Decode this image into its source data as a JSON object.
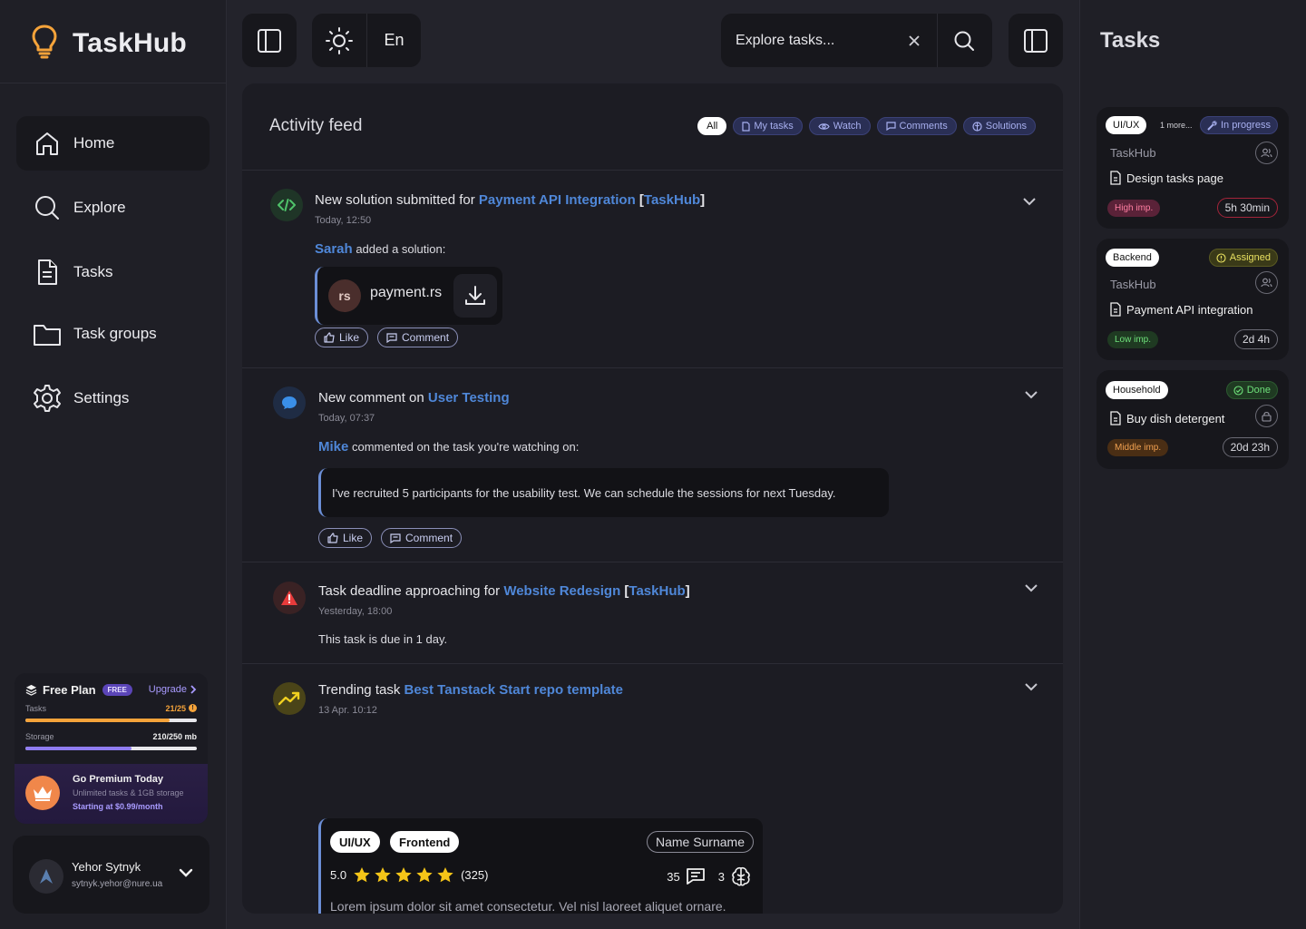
{
  "app": {
    "name": "TaskHub"
  },
  "sidebar": {
    "items": [
      {
        "label": "Home",
        "icon": "home-icon",
        "active": true
      },
      {
        "label": "Explore",
        "icon": "search-icon"
      },
      {
        "label": "Tasks",
        "icon": "document-icon"
      },
      {
        "label": "Task groups",
        "icon": "folder-icon"
      },
      {
        "label": "Settings",
        "icon": "gear-icon"
      }
    ],
    "plan": {
      "title": "Free Plan",
      "badge": "FREE",
      "upgrade": "Upgrade",
      "tasks_label": "Tasks",
      "tasks_value": "21/25",
      "tasks_fraction": 0.84,
      "storage_label": "Storage",
      "storage_value": "210/250 mb",
      "storage_fraction": 0.62,
      "premium_title": "Go Premium Today",
      "premium_subtitle": "Unlimited tasks & 1GB storage",
      "premium_price": "Starting at $0.99/month"
    },
    "user": {
      "name": "Yehor Sytnyk",
      "email": "sytnyk.yehor@nure.ua"
    }
  },
  "topbar": {
    "language": "En",
    "search_placeholder": "Explore tasks..."
  },
  "feed": {
    "title": "Activity feed",
    "filters": [
      {
        "label": "All",
        "icon": "",
        "active": true
      },
      {
        "label": "My tasks",
        "icon": "document-icon"
      },
      {
        "label": "Watch",
        "icon": "eye-icon"
      },
      {
        "label": "Comments",
        "icon": "comment-icon"
      },
      {
        "label": "Solutions",
        "icon": "brain-icon"
      }
    ],
    "items": [
      {
        "type": "solution",
        "prefix": "New solution submitted for ",
        "link": "Payment API Integration",
        "group": "TaskHub",
        "time": "Today, 12:50",
        "actor": "Sarah",
        "action": " added a solution:",
        "file_ext": "rs",
        "file_name": "payment.rs",
        "like": "Like",
        "comment": "Comment"
      },
      {
        "type": "comment",
        "prefix": "New comment on ",
        "link": "User Testing",
        "time": "Today, 07:37",
        "actor": "Mike",
        "action": " commented on the task you're watching on:",
        "quote": "I've recruited 5 participants for the usability test. We can schedule the sessions for next Tuesday.",
        "like": "Like",
        "comment": "Comment"
      },
      {
        "type": "deadline",
        "prefix": "Task deadline approaching for ",
        "link": "Website Redesign",
        "group": "TaskHub",
        "time": "Yesterday, 18:00",
        "body": "This task is due in 1 day."
      },
      {
        "type": "trending",
        "prefix": "Trending task ",
        "link": "Best Tanstack Start repo template",
        "time": "13 Apr. 10:12",
        "tags": [
          "UI/UX",
          "Frontend"
        ],
        "owner": "Name Surname",
        "rating": "5.0",
        "stars": 5,
        "reviews": "(325)",
        "comments_count": "35",
        "solutions_count": "3",
        "description": "Lorem ipsum dolor sit amet consectetur. Vel nisl laoreet aliquet ornare."
      }
    ]
  },
  "tasks_panel": {
    "title": "Tasks",
    "cards": [
      {
        "category": "UI/UX",
        "more": "1 more...",
        "status": "In progress",
        "status_icon": "wrench-icon",
        "project": "TaskHub",
        "name": "Design tasks page",
        "importance": "High imp.",
        "duration": "5h 30min",
        "right_icon": "users-icon"
      },
      {
        "category": "Backend",
        "status": "Assigned",
        "status_icon": "alert-circle-icon",
        "project": "TaskHub",
        "name": "Payment API integration",
        "importance": "Low imp.",
        "duration": "2d 4h",
        "right_icon": "users-icon"
      },
      {
        "category": "Household",
        "status": "Done",
        "status_icon": "check-circle-icon",
        "name": "Buy dish detergent",
        "importance": "Middle imp.",
        "duration": "20d 23h",
        "right_icon": "lock-icon"
      }
    ]
  },
  "colors": {
    "accent_link": "#4f87d8",
    "brand_bulb": "#f5a33a",
    "high_importance": "#e04a6e",
    "low_importance": "#3bb54a",
    "middle_importance": "#e08a3a"
  }
}
